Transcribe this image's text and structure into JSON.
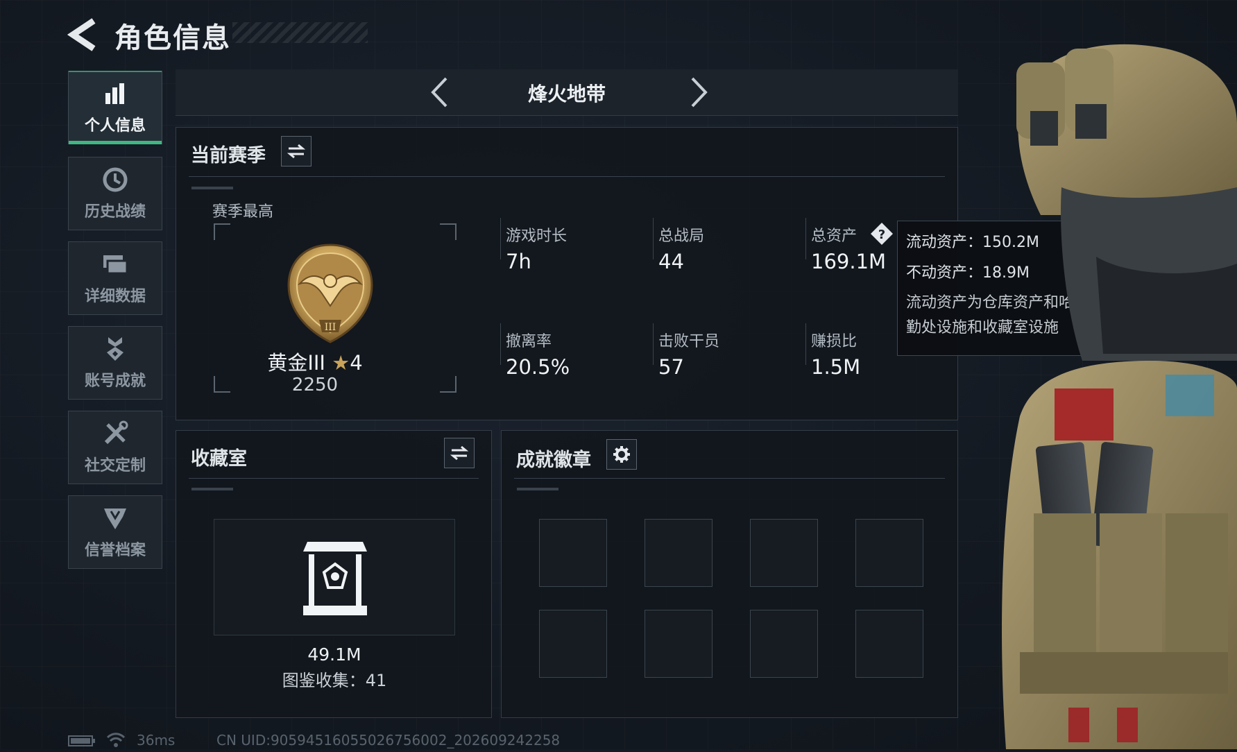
{
  "header": {
    "title": "角色信息"
  },
  "sidebar": {
    "items": [
      {
        "label": "个人信息",
        "icon": "bar-chart-icon",
        "active": true
      },
      {
        "label": "历史战绩",
        "icon": "history-clock-icon",
        "active": false
      },
      {
        "label": "详细数据",
        "icon": "data-cards-icon",
        "active": false
      },
      {
        "label": "账号成就",
        "icon": "achievement-medal-icon",
        "active": false
      },
      {
        "label": "社交定制",
        "icon": "tools-icon",
        "active": false
      },
      {
        "label": "信誉档案",
        "icon": "shield-emblem-icon",
        "active": false
      }
    ]
  },
  "mode_selector": {
    "title": "烽火地带"
  },
  "season": {
    "title": "当前赛季",
    "best_label": "赛季最高",
    "rank_name": "黄金III",
    "rank_stars": "4",
    "rank_points": "2250",
    "stats": [
      {
        "label": "游戏时长",
        "value": "7h"
      },
      {
        "label": "总战局",
        "value": "44"
      },
      {
        "label": "总资产",
        "value": "169.1M"
      },
      {
        "label": "撤离率",
        "value": "20.5%"
      },
      {
        "label": "击败干员",
        "value": "57"
      },
      {
        "label": "赚损比",
        "value": "1.5M"
      }
    ]
  },
  "tooltip": {
    "liquid": "流动资产：150.2M",
    "fixed": "不动资产：18.9M",
    "description": "流动资产为仓库资产和哈夫币，不动资产为特勤处设施和收藏室设施"
  },
  "collection": {
    "title": "收藏室",
    "value": "49.1M",
    "catalog": "图鉴收集：41"
  },
  "badges": {
    "title": "成就徽章",
    "slots": 8
  },
  "status": {
    "ping": "36ms",
    "uid": "CN UID:90594516055026756002_202609242258"
  },
  "colors": {
    "accent": "#3fb783",
    "rank_gold": "#c9a35a"
  }
}
